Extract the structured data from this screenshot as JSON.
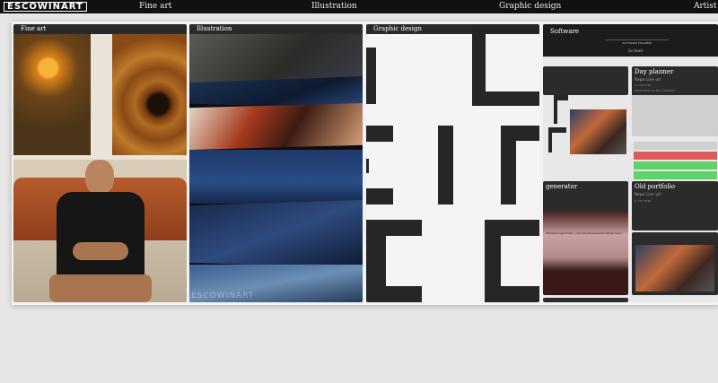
{
  "header": {
    "logo": "ESCOWINART",
    "nav": [
      "Fine art",
      "Illustration",
      "Graphic design",
      "Artist"
    ]
  },
  "panels": {
    "fine_art": {
      "title": "Fine art"
    },
    "illustration": {
      "title": "Illustration",
      "watermark": "ESCOWINART"
    },
    "graphic_design": {
      "title": "Graphic design"
    },
    "software": {
      "title": "Software",
      "subtitle": "SOFTWARE ENGINEER",
      "back_label": "Go back",
      "cards": {
        "day_planner": {
          "title": "Day planner",
          "links": "Repo  Live url",
          "tech": "JS CSS HTML",
          "stack": "BOOTSTRAP JQUERY MOMENT"
        },
        "generator": {
          "title": "generator",
          "sample": "\"Password generator, your secret password will go here.\""
        },
        "old_portfolio": {
          "title": "Old portfolio",
          "links": "Repo  Live url",
          "tech": "JS CSS HTML"
        }
      }
    }
  },
  "colors": {
    "topbar": "#111111",
    "panel_header": "#2a2a2a",
    "planner_red": "#e05a5a",
    "planner_green": "#5fd36a"
  }
}
